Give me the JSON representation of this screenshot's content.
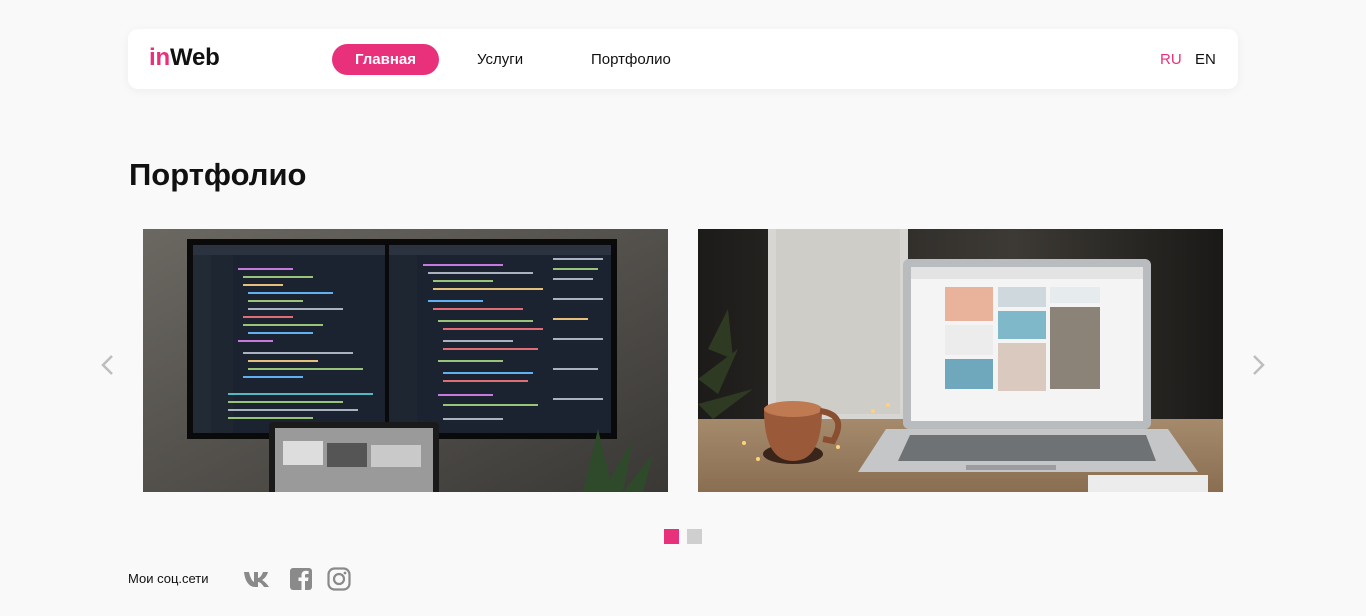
{
  "header": {
    "logo_in": "in",
    "logo_web": "Web",
    "nav": [
      "Главная",
      "Услуги",
      "Портфолио"
    ],
    "languages": [
      "RU",
      "EN"
    ],
    "active_language": "RU"
  },
  "main": {
    "title": "Портфолио",
    "slides": [
      {
        "icon": "monitor-code-photo"
      },
      {
        "icon": "laptop-mug-photo"
      }
    ],
    "pagination": {
      "total": 2,
      "active": 1
    }
  },
  "footer": {
    "social_label": "Мои соц.сети",
    "social_icons": [
      "vk-icon",
      "facebook-icon",
      "instagram-icon"
    ]
  },
  "colors": {
    "accent": "#e8317a",
    "background": "#f9f9f9",
    "inactive_dot": "#cfcfcf",
    "icon_gray": "#8a8a8a"
  }
}
